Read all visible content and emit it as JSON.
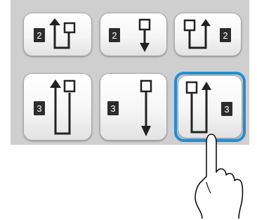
{
  "buttons": [
    {
      "badge": "2",
      "icon": "arrow-up-into-box-icon"
    },
    {
      "badge": "2",
      "icon": "box-arrow-down-icon"
    },
    {
      "badge": "2",
      "icon": "box-arrow-up-icon"
    },
    {
      "badge": "3",
      "icon": "arrow-up-into-box-long-icon"
    },
    {
      "badge": "3",
      "icon": "box-arrow-down-long-icon"
    },
    {
      "badge": "3",
      "icon": "box-arrow-up-long-icon"
    }
  ],
  "selected_index": 5,
  "accent_color": "#1f8fd6",
  "pointer": {
    "icon": "pointing-hand-icon"
  }
}
